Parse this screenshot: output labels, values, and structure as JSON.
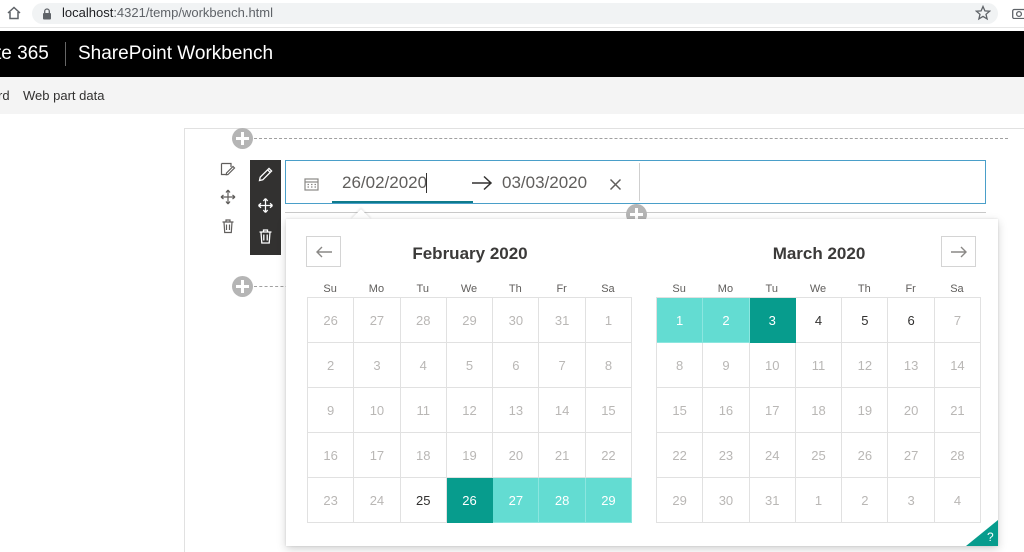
{
  "browser": {
    "host": "localhost",
    "path": ":4321/temp/workbench.html"
  },
  "suite": {
    "app_fragment": "te 365",
    "title": "SharePoint Workbench"
  },
  "command_bar": {
    "left_fragment": "rd",
    "web_part_data": "Web part data"
  },
  "date_range": {
    "from": "26/02/2020",
    "to": "03/03/2020"
  },
  "calendar": {
    "weekdays": [
      "Su",
      "Mo",
      "Tu",
      "We",
      "Th",
      "Fr",
      "Sa"
    ],
    "months": [
      {
        "title": "February 2020",
        "days": [
          {
            "d": "26",
            "s": "out"
          },
          {
            "d": "27",
            "s": "out"
          },
          {
            "d": "28",
            "s": "out"
          },
          {
            "d": "29",
            "s": "out"
          },
          {
            "d": "30",
            "s": "out"
          },
          {
            "d": "31",
            "s": "out"
          },
          {
            "d": "1",
            "s": "out"
          },
          {
            "d": "2",
            "s": "out"
          },
          {
            "d": "3",
            "s": "out"
          },
          {
            "d": "4",
            "s": "out"
          },
          {
            "d": "5",
            "s": "out"
          },
          {
            "d": "6",
            "s": "out"
          },
          {
            "d": "7",
            "s": "out"
          },
          {
            "d": "8",
            "s": "out"
          },
          {
            "d": "9",
            "s": "out"
          },
          {
            "d": "10",
            "s": "out"
          },
          {
            "d": "11",
            "s": "out"
          },
          {
            "d": "12",
            "s": "out"
          },
          {
            "d": "13",
            "s": "out"
          },
          {
            "d": "14",
            "s": "out"
          },
          {
            "d": "15",
            "s": "out"
          },
          {
            "d": "16",
            "s": "out"
          },
          {
            "d": "17",
            "s": "out"
          },
          {
            "d": "18",
            "s": "out"
          },
          {
            "d": "19",
            "s": "out"
          },
          {
            "d": "20",
            "s": "out"
          },
          {
            "d": "21",
            "s": "out"
          },
          {
            "d": "22",
            "s": "out"
          },
          {
            "d": "23",
            "s": "out"
          },
          {
            "d": "24",
            "s": "out"
          },
          {
            "d": "25",
            "s": "in"
          },
          {
            "d": "26",
            "s": "anchor"
          },
          {
            "d": "27",
            "s": "sel"
          },
          {
            "d": "28",
            "s": "sel"
          },
          {
            "d": "29",
            "s": "sel"
          }
        ]
      },
      {
        "title": "March 2020",
        "days": [
          {
            "d": "1",
            "s": "sel"
          },
          {
            "d": "2",
            "s": "sel"
          },
          {
            "d": "3",
            "s": "anchor"
          },
          {
            "d": "4",
            "s": "in"
          },
          {
            "d": "5",
            "s": "in"
          },
          {
            "d": "6",
            "s": "in"
          },
          {
            "d": "7",
            "s": "out"
          },
          {
            "d": "8",
            "s": "out"
          },
          {
            "d": "9",
            "s": "out"
          },
          {
            "d": "10",
            "s": "out"
          },
          {
            "d": "11",
            "s": "out"
          },
          {
            "d": "12",
            "s": "out"
          },
          {
            "d": "13",
            "s": "out"
          },
          {
            "d": "14",
            "s": "out"
          },
          {
            "d": "15",
            "s": "out"
          },
          {
            "d": "16",
            "s": "out"
          },
          {
            "d": "17",
            "s": "out"
          },
          {
            "d": "18",
            "s": "out"
          },
          {
            "d": "19",
            "s": "out"
          },
          {
            "d": "20",
            "s": "out"
          },
          {
            "d": "21",
            "s": "out"
          },
          {
            "d": "22",
            "s": "out"
          },
          {
            "d": "23",
            "s": "out"
          },
          {
            "d": "24",
            "s": "out"
          },
          {
            "d": "25",
            "s": "out"
          },
          {
            "d": "26",
            "s": "out"
          },
          {
            "d": "27",
            "s": "out"
          },
          {
            "d": "28",
            "s": "out"
          },
          {
            "d": "29",
            "s": "out"
          },
          {
            "d": "30",
            "s": "out"
          },
          {
            "d": "31",
            "s": "out"
          },
          {
            "d": "1",
            "s": "out"
          },
          {
            "d": "2",
            "s": "out"
          },
          {
            "d": "3",
            "s": "out"
          },
          {
            "d": "4",
            "s": "out"
          }
        ]
      }
    ],
    "help_glyph": "?"
  },
  "colors": {
    "range_anchor": "#079c8d",
    "range_fill": "#63dcd2",
    "accent_underline": "#0f7b8c",
    "suite_bar": "#000000"
  },
  "icons": [
    "home-icon",
    "lock-icon",
    "star-icon",
    "camera-icon",
    "calendar-icon",
    "arrow-right-icon",
    "close-icon",
    "pencil-icon",
    "move-icon",
    "trash-icon",
    "edit-note-icon",
    "prev-month-icon",
    "next-month-icon",
    "help-icon"
  ]
}
